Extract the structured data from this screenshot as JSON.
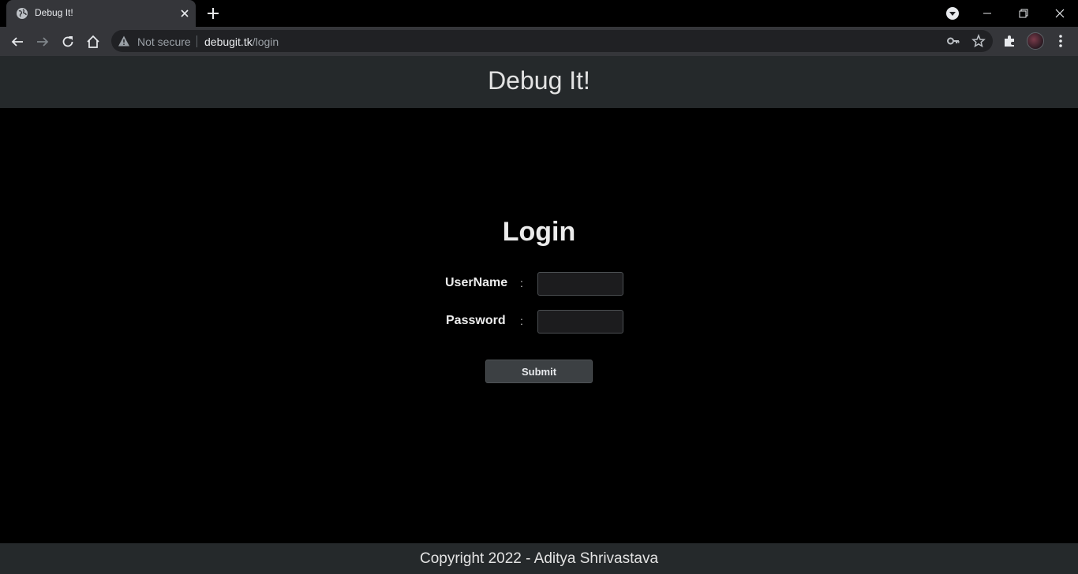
{
  "browser": {
    "tab": {
      "title": "Debug It!",
      "favicon": "globe-icon"
    },
    "address_bar": {
      "security_label": "Not secure",
      "url_host": "debugit.tk",
      "url_path": "/login"
    },
    "colors": {
      "tabstrip": "#000000",
      "toolbar": "#35363a",
      "omnibox": "#202124"
    }
  },
  "header": {
    "title": "Debug It!"
  },
  "login": {
    "heading": "Login",
    "username_label": "UserName",
    "password_label": "Password",
    "separator": ":",
    "username_value": "",
    "password_value": "",
    "submit_label": "Submit"
  },
  "footer": {
    "text": "Copyright 2022 - Aditya Shrivastava"
  },
  "theme": {
    "header_bg": "#25292b",
    "page_bg": "#000000",
    "text": "#ececec",
    "button_bg": "#3c4043"
  }
}
